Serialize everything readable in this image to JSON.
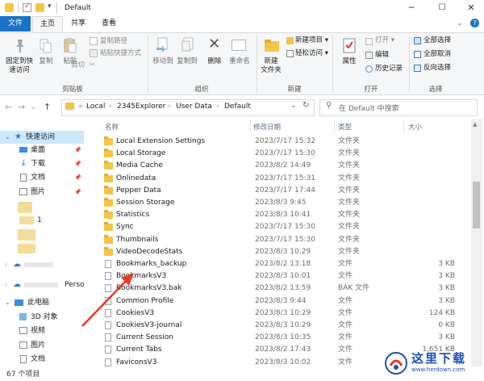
{
  "window": {
    "title": "Default",
    "minimize": "─",
    "maximize": "☐",
    "close": "✕"
  },
  "tabs": [
    {
      "label": "文件"
    },
    {
      "label": "主页"
    },
    {
      "label": "共享"
    },
    {
      "label": "查看"
    }
  ],
  "ribbon": {
    "pin_line1": "固定到快",
    "pin_line2": "速访问",
    "copy": "复制",
    "paste": "粘贴",
    "copy_path": "复制路径",
    "paste_shortcut": "粘贴快捷方式",
    "cut": "剪切",
    "clipboard_group": "剪贴板",
    "move_to": "移动到",
    "copy_to": "复制到",
    "delete": "删除",
    "rename": "重命名",
    "organize_group": "组织",
    "new_folder_line1": "新建",
    "new_folder_line2": "文件夹",
    "new_item": "新建项目 ▾",
    "easy_access": "轻松访问 ▾",
    "new_group": "新建",
    "properties": "属性",
    "open": "打开 ▾",
    "edit": "编辑",
    "history": "历史记录",
    "open_group": "打开",
    "select_all": "全部选择",
    "select_none": "全部取消",
    "invert_selection": "反向选择",
    "select_group": "选择"
  },
  "address": {
    "crumbs": [
      "«",
      "Local",
      "›",
      "2345Explorer",
      "›",
      "User Data",
      "›",
      "Default"
    ],
    "search_placeholder": "在 Default 中搜索"
  },
  "nav": {
    "quick_access": "快速访问",
    "desktop": "桌面",
    "downloads": "下载",
    "documents": "文档",
    "pictures": "图片",
    "item_1": "1",
    "onedrive_person": "Perso",
    "this_pc": "此电脑",
    "objects_3d": "3D 对象",
    "videos": "视频",
    "pictures2": "图片",
    "documents2": "文档"
  },
  "columns": {
    "name": "名称",
    "date": "修改日期",
    "type": "类型",
    "size": "大小"
  },
  "files": [
    {
      "name": "Local Extension Settings",
      "date": "2023/7/17 15:32",
      "type": "文件夹",
      "size": "",
      "kind": "folder"
    },
    {
      "name": "Local Storage",
      "date": "2023/7/17 15:30",
      "type": "文件夹",
      "size": "",
      "kind": "folder"
    },
    {
      "name": "Media Cache",
      "date": "2023/8/2 14:49",
      "type": "文件夹",
      "size": "",
      "kind": "folder"
    },
    {
      "name": "Onlinedata",
      "date": "2023/7/17 15:31",
      "type": "文件夹",
      "size": "",
      "kind": "folder"
    },
    {
      "name": "Pepper Data",
      "date": "2023/7/17 17:44",
      "type": "文件夹",
      "size": "",
      "kind": "folder"
    },
    {
      "name": "Session Storage",
      "date": "2023/8/3 9:45",
      "type": "文件夹",
      "size": "",
      "kind": "folder"
    },
    {
      "name": "Statistics",
      "date": "2023/8/3 10:41",
      "type": "文件夹",
      "size": "",
      "kind": "folder"
    },
    {
      "name": "Sync",
      "date": "2023/7/17 15:30",
      "type": "文件夹",
      "size": "",
      "kind": "folder"
    },
    {
      "name": "Thumbnails",
      "date": "2023/7/17 15:30",
      "type": "文件夹",
      "size": "",
      "kind": "folder"
    },
    {
      "name": "VideoDecodeStats",
      "date": "2023/8/3 10:29",
      "type": "文件夹",
      "size": "",
      "kind": "folder"
    },
    {
      "name": "Bookmarks_backup",
      "date": "2023/8/2 13:18",
      "type": "文件",
      "size": "3 KB",
      "kind": "file"
    },
    {
      "name": "BookmarksV3",
      "date": "2023/8/3 10:01",
      "type": "文件",
      "size": "3 KB",
      "kind": "file"
    },
    {
      "name": "BookmarksV3.bak",
      "date": "2023/8/2 13:59",
      "type": "BAK 文件",
      "size": "3 KB",
      "kind": "file"
    },
    {
      "name": "Common Profile",
      "date": "2023/8/3 9:44",
      "type": "文件",
      "size": "3 KB",
      "kind": "file"
    },
    {
      "name": "CookiesV3",
      "date": "2023/8/3 10:29",
      "type": "文件",
      "size": "124 KB",
      "kind": "file"
    },
    {
      "name": "CookiesV3-journal",
      "date": "2023/8/3 10:29",
      "type": "文件",
      "size": "0 KB",
      "kind": "file"
    },
    {
      "name": "Current Session",
      "date": "2023/8/3 10:35",
      "type": "文件",
      "size": "3 KB",
      "kind": "file"
    },
    {
      "name": "Current Tabs",
      "date": "2023/8/2 17:43",
      "type": "文件",
      "size": "1,651 KB",
      "kind": "file"
    },
    {
      "name": "FaviconsV3",
      "date": "2023/8/3 10:02",
      "type": "文件",
      "size": "",
      "kind": "file"
    }
  ],
  "status": {
    "count": "67 个项目"
  },
  "watermark": {
    "text": "这里下载",
    "url": "www.herdown.com"
  },
  "colors": {
    "file_tab": "#1a73c8",
    "folder": "#f2c54b",
    "selected": "#cce8ff",
    "arrow": "#e53b2c"
  }
}
